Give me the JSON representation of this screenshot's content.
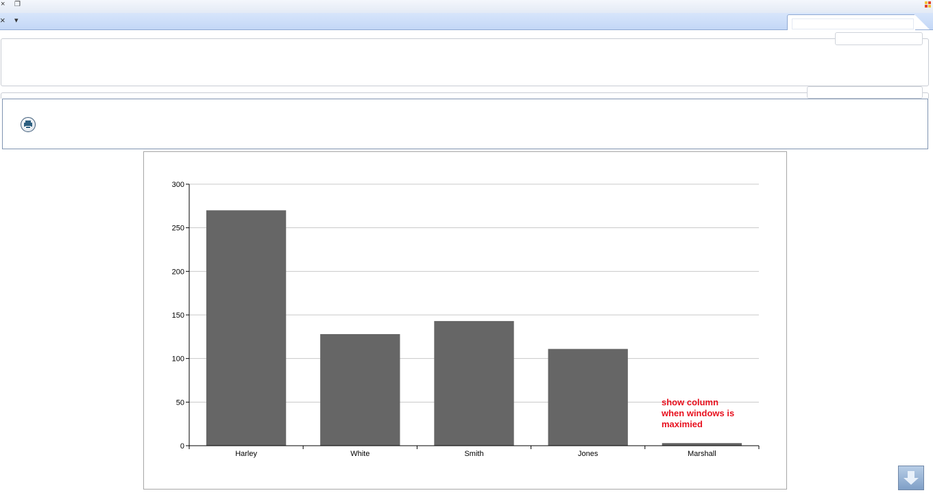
{
  "window": {
    "close_glyph": "×",
    "restore_glyph": "❐",
    "tab_close_glyph": "×",
    "tab_menu_glyph": "▾"
  },
  "toolbar": {
    "print_icon": "print-icon"
  },
  "colors": {
    "bar": "#666666",
    "grid": "#c8c8c8",
    "axis": "#000000",
    "annotation": "#e8101e",
    "toolbar_border": "#7f93b0",
    "tabstrip": "#c3d7f6"
  },
  "chart_data": {
    "type": "bar",
    "categories": [
      "Harley",
      "White",
      "Smith",
      "Jones",
      "Marshall"
    ],
    "values": [
      270,
      128,
      143,
      111,
      3
    ],
    "yticks": [
      "0",
      "50",
      "100",
      "150",
      "200",
      "250",
      "300"
    ],
    "ylim": [
      0,
      300
    ],
    "grid": true,
    "title": "",
    "xlabel": "",
    "ylabel": "",
    "annotation": {
      "lines": [
        "show column",
        "when windows is",
        "maximied"
      ]
    }
  }
}
